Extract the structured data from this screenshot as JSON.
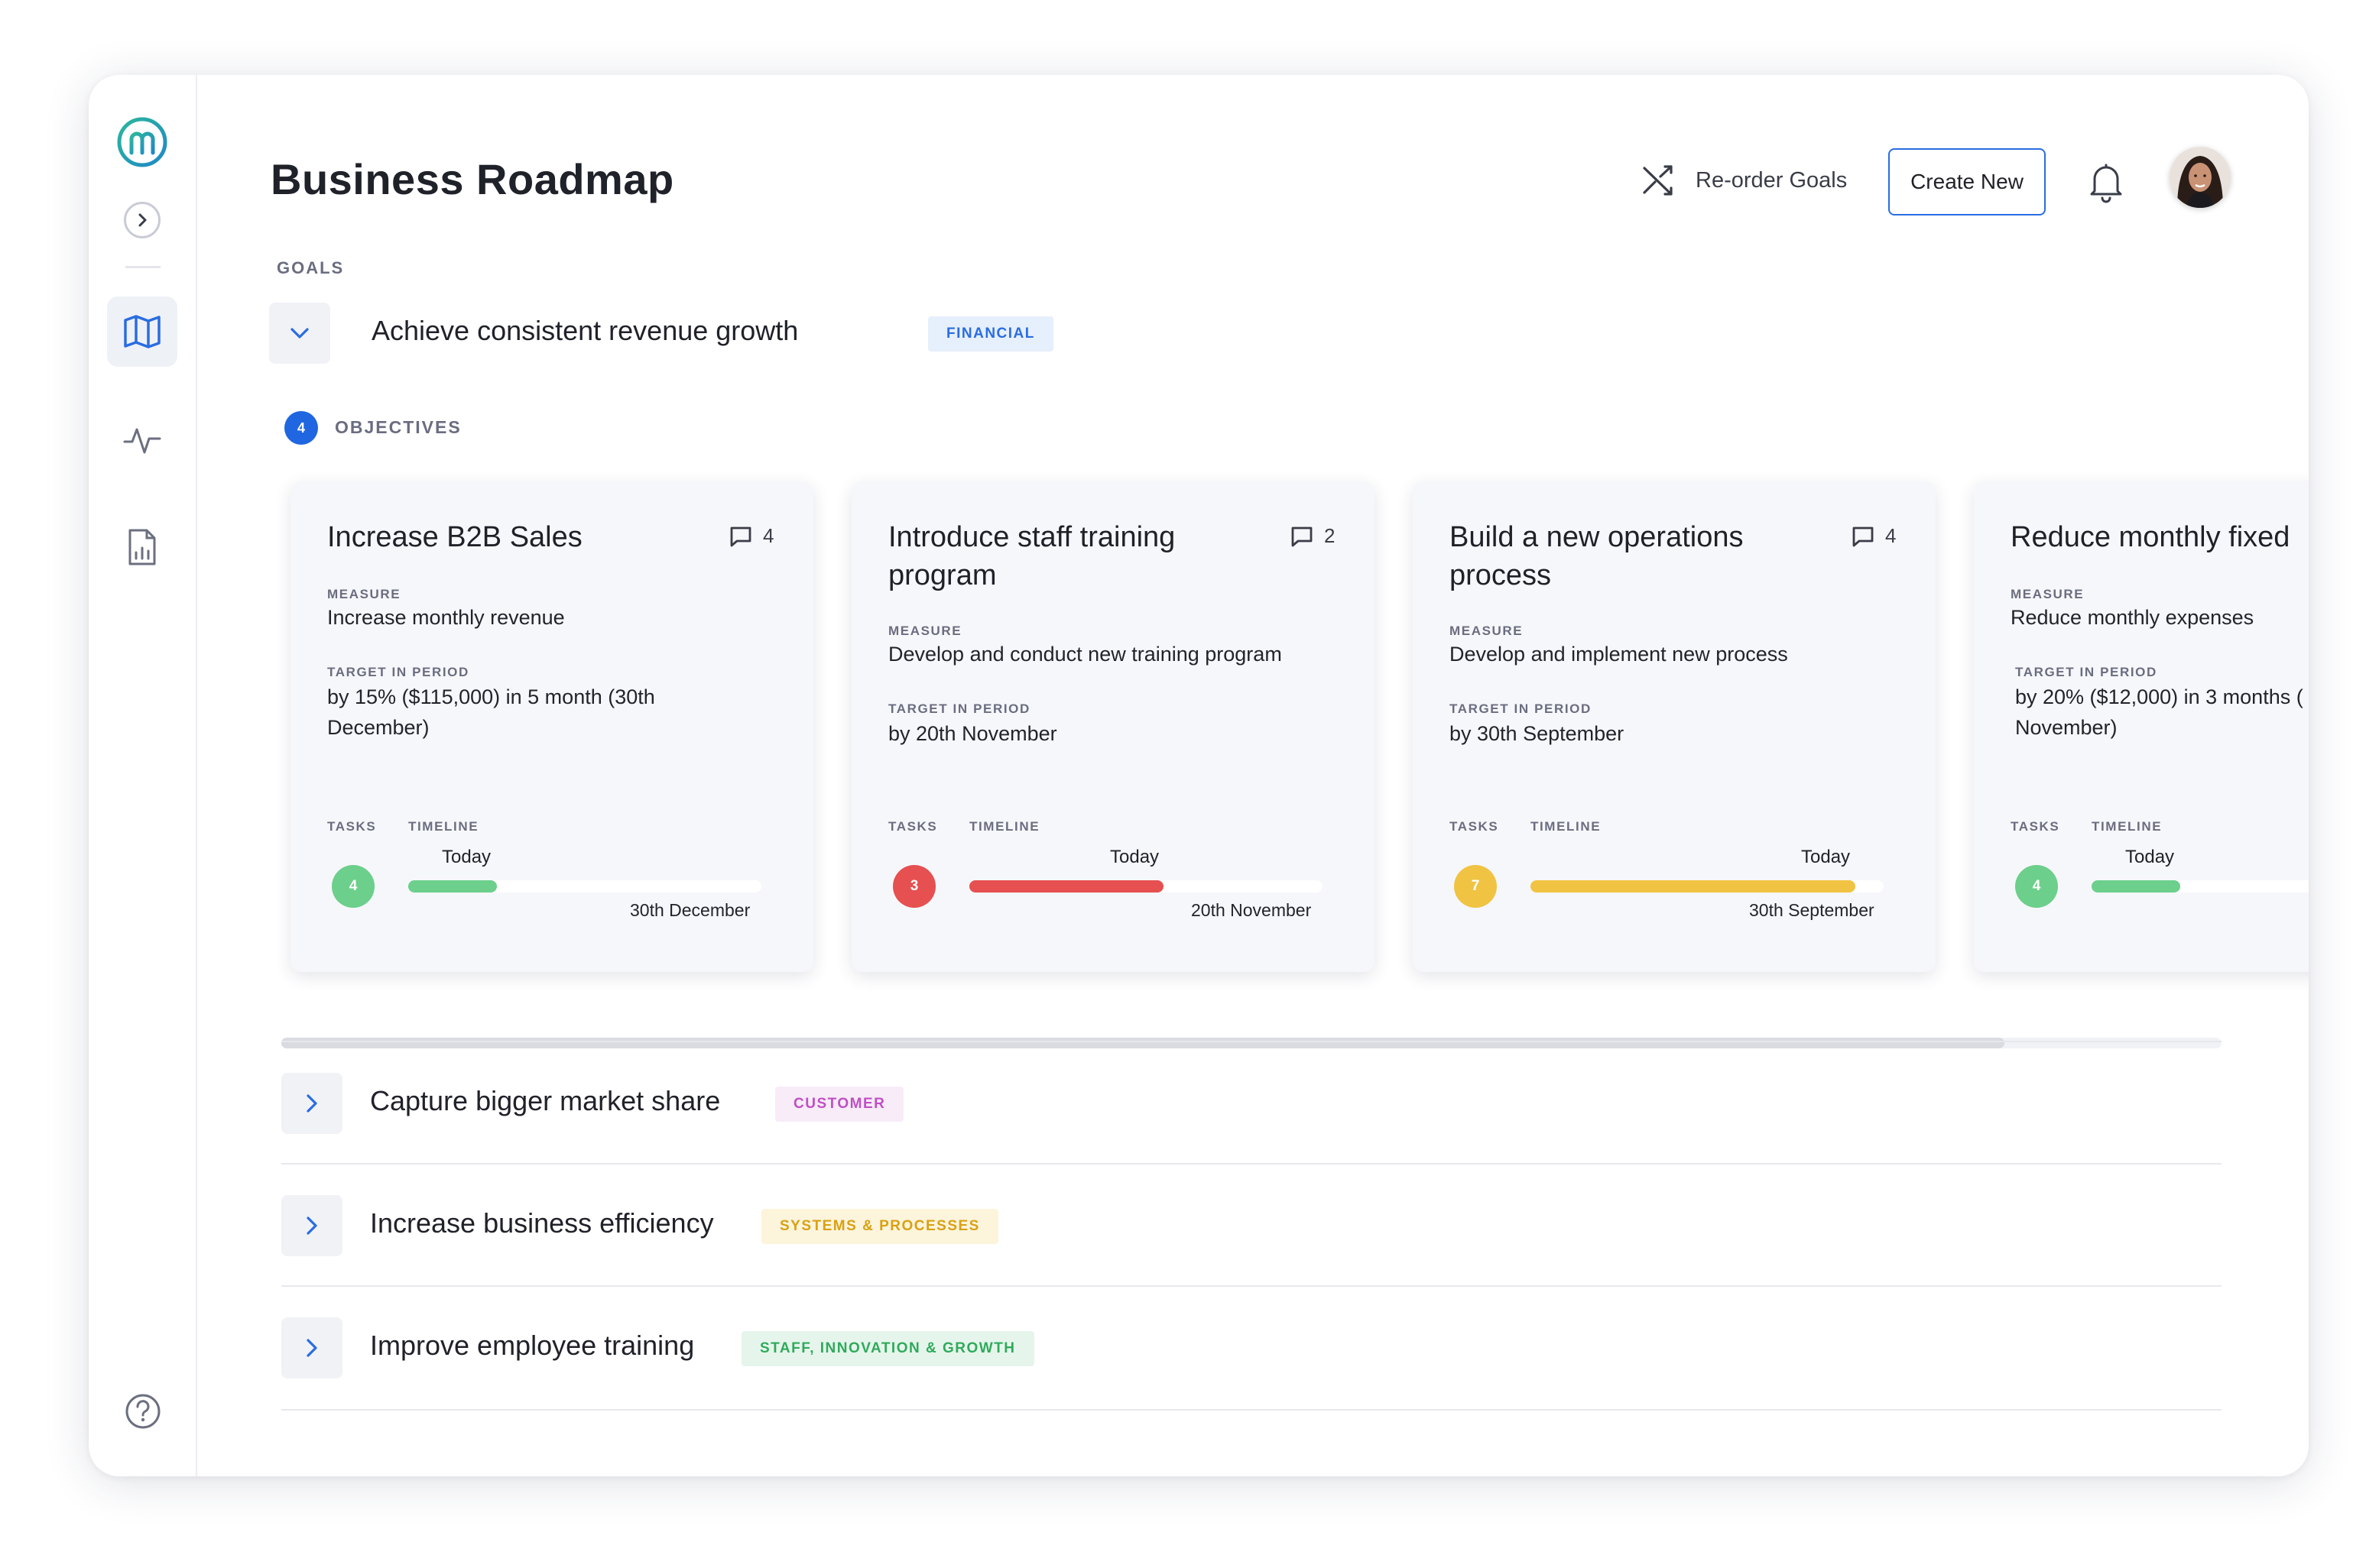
{
  "header": {
    "title": "Business Roadmap",
    "reorder_label": "Re-order Goals",
    "create_label": "Create New"
  },
  "goals_label": "GOALS",
  "objectives": {
    "count": "4",
    "label": "OBJECTIVES"
  },
  "goals": [
    {
      "title": "Achieve consistent revenue growth",
      "tag": "FINANCIAL",
      "tag_color": "#2a6de1",
      "tag_bg": "#e6effc",
      "expanded": true
    },
    {
      "title": "Capture bigger market share",
      "tag": "CUSTOMER",
      "tag_color": "#c04fc4",
      "tag_bg": "#f7ecf8",
      "expanded": false
    },
    {
      "title": "Increase business efficiency",
      "tag": "SYSTEMS & PROCESSES",
      "tag_color": "#d9a113",
      "tag_bg": "#fdf4dc",
      "expanded": false
    },
    {
      "title": "Improve employee training",
      "tag": "STAFF, INNOVATION & GROWTH",
      "tag_color": "#2faa5b",
      "tag_bg": "#e6f5ec",
      "expanded": false
    }
  ],
  "labels": {
    "measure": "MEASURE",
    "target": "TARGET IN PERIOD",
    "tasks": "TASKS",
    "timeline": "TIMELINE",
    "today": "Today"
  },
  "cards": [
    {
      "title": "Increase B2B Sales",
      "comments": "4",
      "measure": "Increase monthly revenue",
      "target": "by 15% ($115,000) in 5 month (30th December)",
      "tasks": "4",
      "color": "#6ccf8b",
      "progress": 0.25,
      "end_date": "30th December"
    },
    {
      "title": "Introduce staff training program",
      "comments": "2",
      "measure": "Develop and conduct new training program",
      "target": "by 20th November",
      "tasks": "3",
      "color": "#e65050",
      "progress": 0.55,
      "end_date": "20th November"
    },
    {
      "title": "Build a new operations process",
      "comments": "4",
      "measure": "Develop and implement new process",
      "target": "by 30th September",
      "tasks": "7",
      "color": "#f1c343",
      "progress": 0.92,
      "end_date": "30th September"
    },
    {
      "title": "Reduce monthly fixed",
      "comments": "",
      "measure": "Reduce monthly expenses",
      "target": "by 20% ($12,000) in 3 months (",
      "target2": "November)",
      "tasks": "4",
      "color": "#6ccf8b",
      "progress": 0.25,
      "end_date": ""
    }
  ],
  "colors": {
    "accent": "#2a6de1",
    "logo_green": "#25b89a"
  }
}
